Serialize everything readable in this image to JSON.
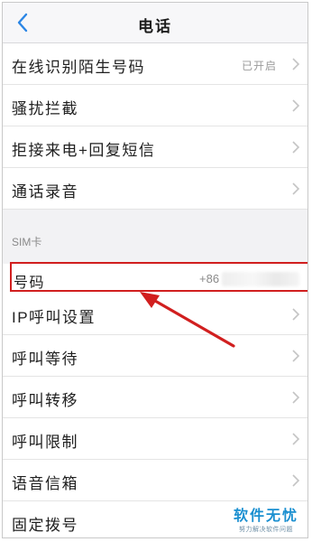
{
  "header": {
    "title": "电话",
    "back_icon": "chevron-left-icon",
    "accent_color": "#2b86e5"
  },
  "settings": [
    {
      "label": "在线识别陌生号码",
      "value": "已开启"
    },
    {
      "label": "骚扰拦截",
      "value": ""
    },
    {
      "label": "拒接来电+回复短信",
      "value": ""
    },
    {
      "label": "通话录音",
      "value": ""
    }
  ],
  "sim_section": {
    "header": "SIM卡",
    "phone": {
      "label": "号码",
      "value": "+86"
    },
    "items": [
      {
        "label": "IP呼叫设置"
      },
      {
        "label": "呼叫等待"
      },
      {
        "label": "呼叫转移"
      },
      {
        "label": "呼叫限制"
      },
      {
        "label": "语音信箱"
      },
      {
        "label": "固定拨号"
      }
    ]
  },
  "annotation": {
    "highlight_color": "#d11f1f"
  },
  "watermark": {
    "main": "软件无忧",
    "sub": "努力解决软件问题"
  }
}
